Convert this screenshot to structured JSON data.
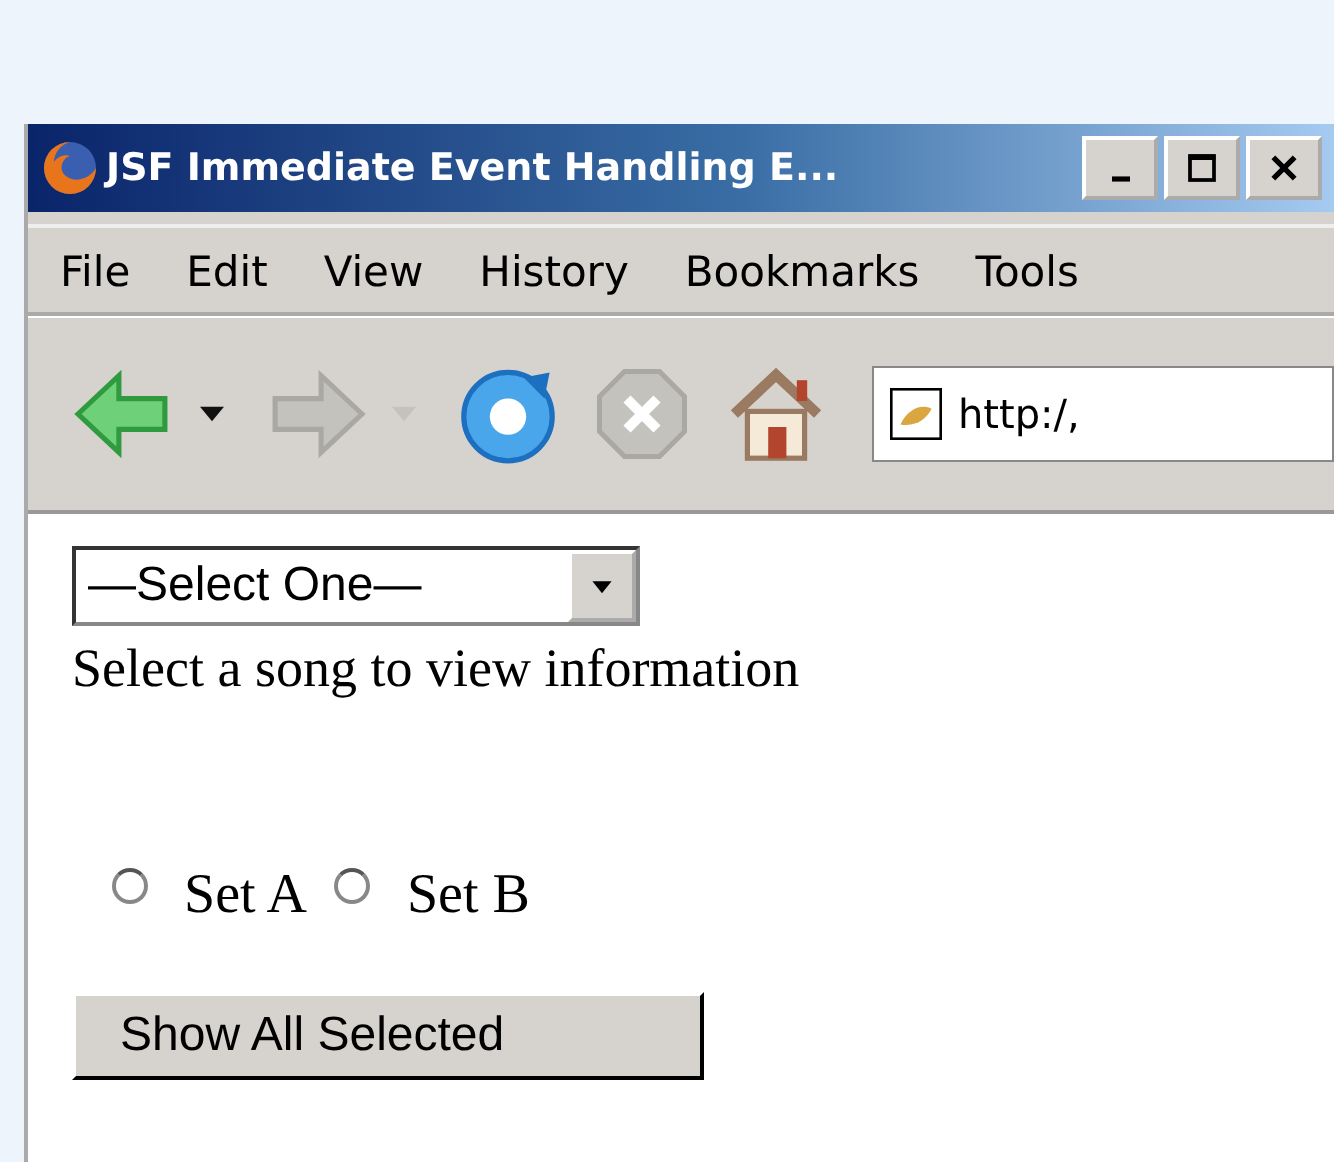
{
  "window": {
    "title": "JSF Immediate Event Handling E..."
  },
  "menu": [
    {
      "label": "File"
    },
    {
      "label": "Edit"
    },
    {
      "label": "View"
    },
    {
      "label": "History"
    },
    {
      "label": "Bookmarks"
    },
    {
      "label": "Tools"
    }
  ],
  "toolbar": {
    "buttons": [
      {
        "kind": "back",
        "disabled": false
      },
      {
        "kind": "back-menu",
        "disabled": false
      },
      {
        "kind": "forward",
        "disabled": true
      },
      {
        "kind": "forward-menu",
        "disabled": true
      },
      {
        "kind": "reload",
        "disabled": false
      },
      {
        "kind": "stop",
        "disabled": true
      },
      {
        "kind": "home",
        "disabled": false
      }
    ],
    "address": "http:/,"
  },
  "page": {
    "dropdown": {
      "value": "—Select One—"
    },
    "message": "Select a song to view information",
    "radios": [
      {
        "label": "Set A",
        "selected": false
      },
      {
        "label": "Set B",
        "selected": false
      }
    ],
    "button": "Show All Selected"
  }
}
